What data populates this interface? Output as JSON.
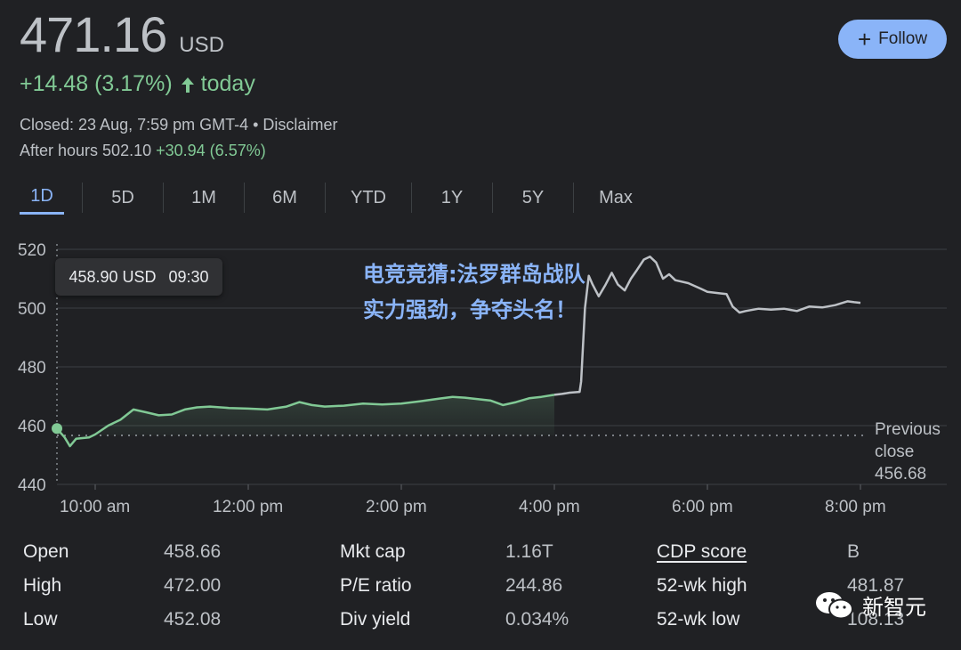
{
  "header": {
    "price": "471.16",
    "currency": "USD",
    "change": "+14.48 (3.17%)",
    "change_suffix": "today",
    "closed": "Closed: 23 Aug, 7:59 pm GMT-4 • Disclaimer",
    "after_hours_label": "After hours 502.10",
    "after_hours_change": "+30.94 (6.57%)",
    "follow_label": "Follow",
    "up_arrow_icon": "arrow-up-icon",
    "plus_icon": "plus-icon"
  },
  "tabs": [
    {
      "label": "1D",
      "active": true
    },
    {
      "label": "5D"
    },
    {
      "label": "1M"
    },
    {
      "label": "6M"
    },
    {
      "label": "YTD"
    },
    {
      "label": "1Y"
    },
    {
      "label": "5Y"
    },
    {
      "label": "Max"
    }
  ],
  "tooltip": {
    "price": "458.90 USD",
    "time": "09:30"
  },
  "overlay_title": "电竞竞猜:法罗群岛战队实力强劲，争夺头名！",
  "previous_close": {
    "line1": "Previous",
    "line2": "close",
    "value": "456.68"
  },
  "chart_data": {
    "type": "line",
    "x_tick_labels": [
      "10:00 am",
      "12:00 pm",
      "2:00 pm",
      "4:00 pm",
      "6:00 pm",
      "8:00 pm"
    ],
    "y_tick_labels": [
      "520",
      "500",
      "480",
      "460",
      "440"
    ],
    "ylim": [
      440,
      520
    ],
    "xlim_hours": [
      9.5,
      20.0
    ],
    "previous_close": 456.68,
    "regular_session_end_hour": 16.0,
    "series": [
      {
        "points": [
          [
            9.5,
            459.0
          ],
          [
            9.6,
            456.0
          ],
          [
            9.67,
            453.0
          ],
          [
            9.75,
            455.5
          ],
          [
            9.92,
            456.0
          ],
          [
            10.0,
            457.0
          ],
          [
            10.17,
            460.0
          ],
          [
            10.33,
            462.0
          ],
          [
            10.5,
            465.5
          ],
          [
            10.67,
            464.5
          ],
          [
            10.83,
            463.5
          ],
          [
            11.0,
            463.8
          ],
          [
            11.17,
            465.5
          ],
          [
            11.33,
            466.2
          ],
          [
            11.5,
            466.5
          ],
          [
            11.75,
            466.0
          ],
          [
            12.0,
            465.8
          ],
          [
            12.25,
            465.5
          ],
          [
            12.5,
            466.5
          ],
          [
            12.67,
            468.0
          ],
          [
            12.83,
            467.0
          ],
          [
            13.0,
            466.5
          ],
          [
            13.25,
            466.8
          ],
          [
            13.5,
            467.5
          ],
          [
            13.75,
            467.2
          ],
          [
            14.0,
            467.5
          ],
          [
            14.25,
            468.3
          ],
          [
            14.5,
            469.2
          ],
          [
            14.67,
            469.8
          ],
          [
            14.83,
            469.5
          ],
          [
            15.0,
            469.0
          ],
          [
            15.17,
            468.5
          ],
          [
            15.33,
            467.0
          ],
          [
            15.5,
            468.0
          ],
          [
            15.67,
            469.3
          ],
          [
            15.83,
            469.8
          ],
          [
            16.0,
            470.5
          ],
          [
            16.1,
            470.8
          ],
          [
            16.2,
            471.2
          ],
          [
            16.33,
            471.5
          ],
          [
            16.35,
            475.0
          ],
          [
            16.4,
            500.0
          ],
          [
            16.45,
            511.0
          ],
          [
            16.5,
            508.0
          ],
          [
            16.58,
            504.0
          ],
          [
            16.67,
            508.0
          ],
          [
            16.75,
            512.0
          ],
          [
            16.83,
            508.0
          ],
          [
            16.92,
            506.0
          ],
          [
            17.0,
            510.0
          ],
          [
            17.08,
            513.0
          ],
          [
            17.17,
            516.5
          ],
          [
            17.25,
            517.5
          ],
          [
            17.33,
            515.5
          ],
          [
            17.42,
            510.0
          ],
          [
            17.5,
            511.5
          ],
          [
            17.58,
            509.5
          ],
          [
            17.75,
            508.5
          ],
          [
            17.92,
            506.5
          ],
          [
            18.0,
            505.5
          ],
          [
            18.17,
            505.0
          ],
          [
            18.25,
            504.8
          ],
          [
            18.33,
            500.5
          ],
          [
            18.42,
            498.5
          ],
          [
            18.5,
            499.0
          ],
          [
            18.67,
            499.8
          ],
          [
            18.83,
            499.5
          ],
          [
            19.0,
            499.8
          ],
          [
            19.17,
            499.0
          ],
          [
            19.33,
            500.5
          ],
          [
            19.5,
            500.2
          ],
          [
            19.67,
            501.0
          ],
          [
            19.83,
            502.3
          ],
          [
            19.92,
            502.0
          ],
          [
            20.0,
            501.8
          ]
        ]
      }
    ]
  },
  "stats": {
    "col1": [
      {
        "label": "Open",
        "value": "458.66"
      },
      {
        "label": "High",
        "value": "472.00"
      },
      {
        "label": "Low",
        "value": "452.08"
      }
    ],
    "col2": [
      {
        "label": "Mkt cap",
        "value": "1.16T"
      },
      {
        "label": "P/E ratio",
        "value": "244.86"
      },
      {
        "label": "Div yield",
        "value": "0.034%"
      }
    ],
    "col3": [
      {
        "label": "CDP score",
        "value": "B"
      },
      {
        "label": "52-wk high",
        "value": "481.87"
      },
      {
        "label": "52-wk low",
        "value": "108.13"
      }
    ]
  },
  "watermark": {
    "text": "新智元",
    "icon": "wechat-icon"
  },
  "colors": {
    "green": "#81c995",
    "grey_line": "#bdc1c6",
    "accent": "#8ab4f8",
    "background": "#202124"
  }
}
